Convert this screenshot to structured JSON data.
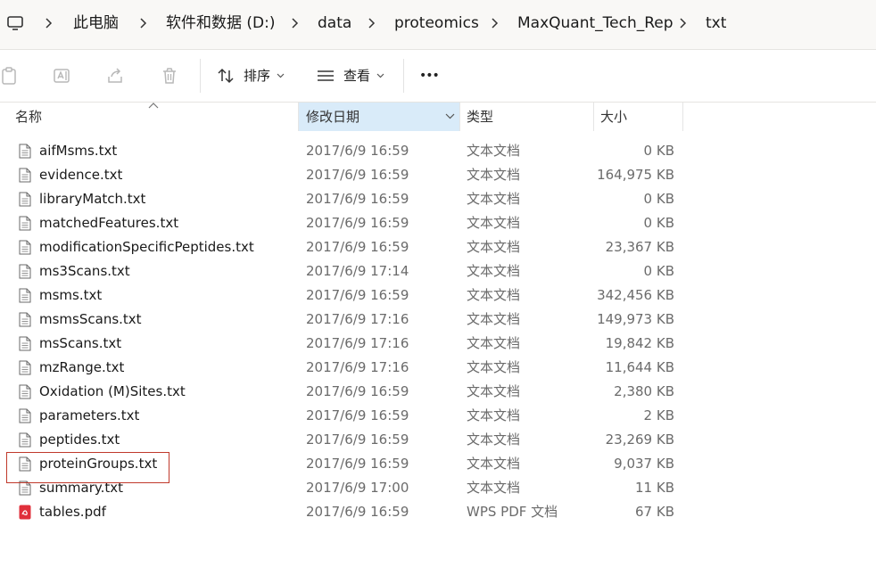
{
  "breadcrumb": {
    "items": [
      "此电脑",
      "软件和数据 (D:)",
      "data",
      "proteomics",
      "MaxQuant_Tech_Rep",
      "txt"
    ]
  },
  "toolbar": {
    "sort_label": "排序",
    "view_label": "查看",
    "more_label": "•••"
  },
  "columns": {
    "name": "名称",
    "date": "修改日期",
    "type": "类型",
    "size": "大小"
  },
  "files": [
    {
      "name": "aifMsms.txt",
      "date": "2017/6/9 16:59",
      "type": "文本文档",
      "size": "0 KB",
      "icon": "text-file-icon"
    },
    {
      "name": "evidence.txt",
      "date": "2017/6/9 16:59",
      "type": "文本文档",
      "size": "164,975 KB",
      "icon": "text-file-icon"
    },
    {
      "name": "libraryMatch.txt",
      "date": "2017/6/9 16:59",
      "type": "文本文档",
      "size": "0 KB",
      "icon": "text-file-icon"
    },
    {
      "name": "matchedFeatures.txt",
      "date": "2017/6/9 16:59",
      "type": "文本文档",
      "size": "0 KB",
      "icon": "text-file-icon"
    },
    {
      "name": "modificationSpecificPeptides.txt",
      "date": "2017/6/9 16:59",
      "type": "文本文档",
      "size": "23,367 KB",
      "icon": "text-file-icon"
    },
    {
      "name": "ms3Scans.txt",
      "date": "2017/6/9 17:14",
      "type": "文本文档",
      "size": "0 KB",
      "icon": "text-file-icon"
    },
    {
      "name": "msms.txt",
      "date": "2017/6/9 16:59",
      "type": "文本文档",
      "size": "342,456 KB",
      "icon": "text-file-icon"
    },
    {
      "name": "msmsScans.txt",
      "date": "2017/6/9 17:16",
      "type": "文本文档",
      "size": "149,973 KB",
      "icon": "text-file-icon"
    },
    {
      "name": "msScans.txt",
      "date": "2017/6/9 17:16",
      "type": "文本文档",
      "size": "19,842 KB",
      "icon": "text-file-icon"
    },
    {
      "name": "mzRange.txt",
      "date": "2017/6/9 17:16",
      "type": "文本文档",
      "size": "11,644 KB",
      "icon": "text-file-icon"
    },
    {
      "name": "Oxidation (M)Sites.txt",
      "date": "2017/6/9 16:59",
      "type": "文本文档",
      "size": "2,380 KB",
      "icon": "text-file-icon"
    },
    {
      "name": "parameters.txt",
      "date": "2017/6/9 16:59",
      "type": "文本文档",
      "size": "2 KB",
      "icon": "text-file-icon"
    },
    {
      "name": "peptides.txt",
      "date": "2017/6/9 16:59",
      "type": "文本文档",
      "size": "23,269 KB",
      "icon": "text-file-icon"
    },
    {
      "name": "proteinGroups.txt",
      "date": "2017/6/9 16:59",
      "type": "文本文档",
      "size": "9,037 KB",
      "icon": "text-file-icon"
    },
    {
      "name": "summary.txt",
      "date": "2017/6/9 17:00",
      "type": "文本文档",
      "size": "11 KB",
      "icon": "text-file-icon"
    },
    {
      "name": "tables.pdf",
      "date": "2017/6/9 16:59",
      "type": "WPS PDF 文档",
      "size": "67 KB",
      "icon": "pdf-file-icon"
    }
  ],
  "colors": {
    "active_column_bg": "#d9ebf9",
    "highlight_border": "#c0392b",
    "pdf_icon": "#e0303b"
  }
}
